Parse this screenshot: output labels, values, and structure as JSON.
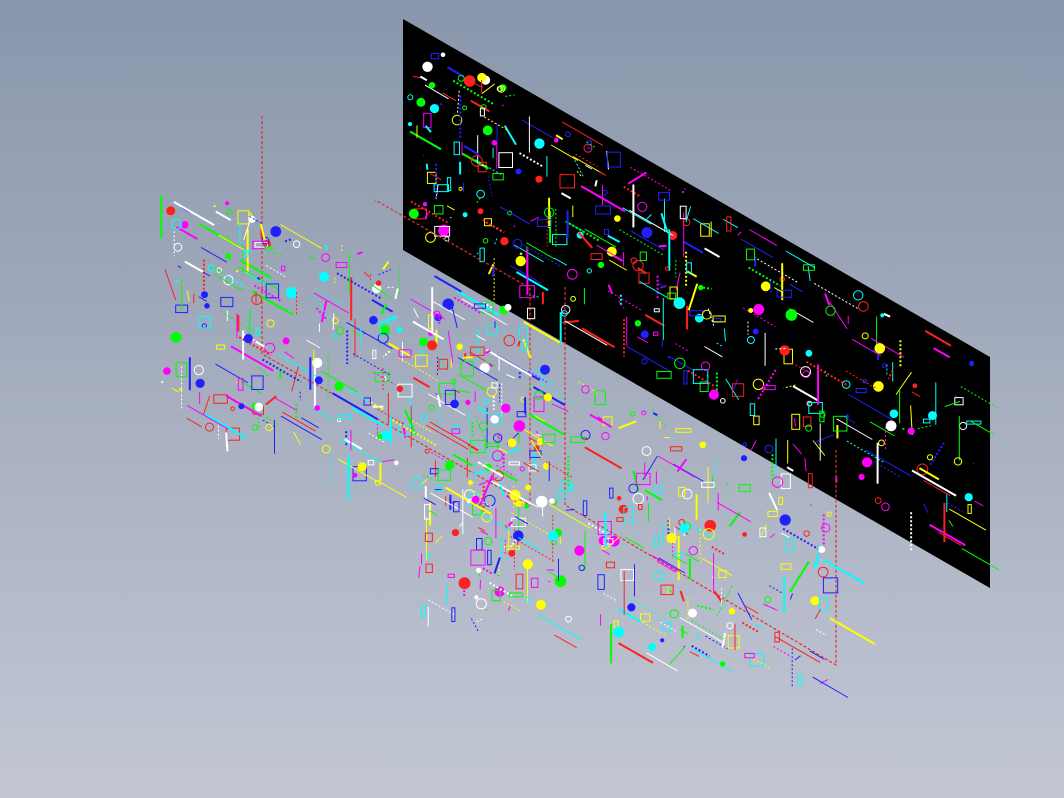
{
  "viewport": {
    "background_top": "#8996AB",
    "background_bottom": "#C3C7D4"
  },
  "sheets": [
    {
      "name": "black-drawing-sheet",
      "fill": "#000000"
    },
    {
      "name": "red-frame-sheet-left",
      "border": "#E03030"
    },
    {
      "name": "red-frame-sheet-right",
      "border": "#E03030"
    }
  ],
  "cad_palette": [
    "#00FF00",
    "#FF2020",
    "#00FFFF",
    "#2020FF",
    "#FFFF00",
    "#FF00FF",
    "#FFFFFF"
  ]
}
